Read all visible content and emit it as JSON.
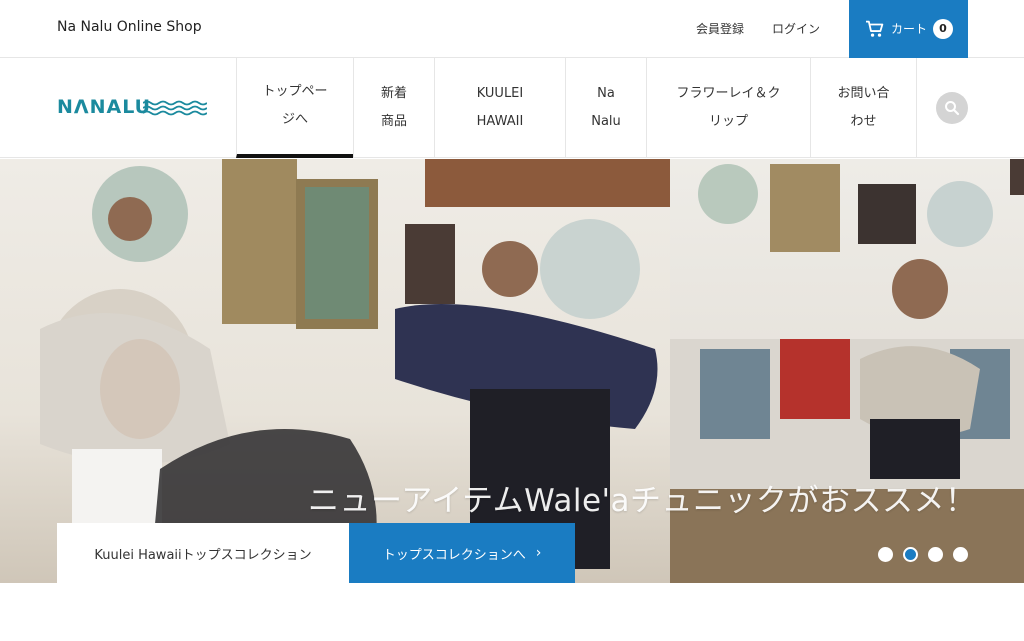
{
  "topbar": {
    "shop_name": "Na Nalu Online Shop",
    "register_label": "会員登録",
    "login_label": "ログイン",
    "cart_label": "カート",
    "cart_count": "0",
    "cart_icon": "cart-icon",
    "accent_color": "#1a7cc2"
  },
  "navbar": {
    "logo_text": "NΛNALU",
    "logo_icon": "wave-icon",
    "items": [
      {
        "label": "トップペー\nジへ"
      },
      {
        "label": "新着\n商品"
      },
      {
        "label": "KUULEI\nHAWAII"
      },
      {
        "label": "Na\nNalu"
      },
      {
        "label": "フラワーレイ＆ク\nリップ"
      },
      {
        "label": "お問い合\nわせ"
      }
    ],
    "search_icon": "search-icon"
  },
  "hero": {
    "headline": "ニューアイテムWale'aチュニックがおススメ！",
    "caption": "Kuulei Hawaiiトップスコレクション",
    "button_label": "トップスコレクションへ",
    "button_icon": "chevron-right-icon",
    "slide_count": 4,
    "active_slide": 2
  }
}
